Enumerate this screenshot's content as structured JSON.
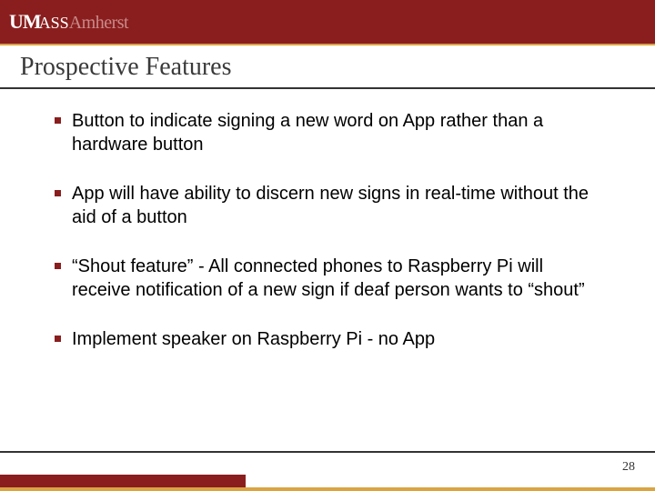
{
  "logo": {
    "um": "UM",
    "ass": "ASS",
    "amherst": "Amherst"
  },
  "title": "Prospective Features",
  "bullets": [
    "Button to indicate signing a new word on App rather than a hardware button",
    "App will have ability to discern new signs in real-time without the aid of a button",
    "“Shout feature” - All connected phones to Raspberry Pi will receive notification of a new sign if deaf person wants to “shout”",
    "Implement speaker on Raspberry Pi - no App"
  ],
  "page_number": "28"
}
